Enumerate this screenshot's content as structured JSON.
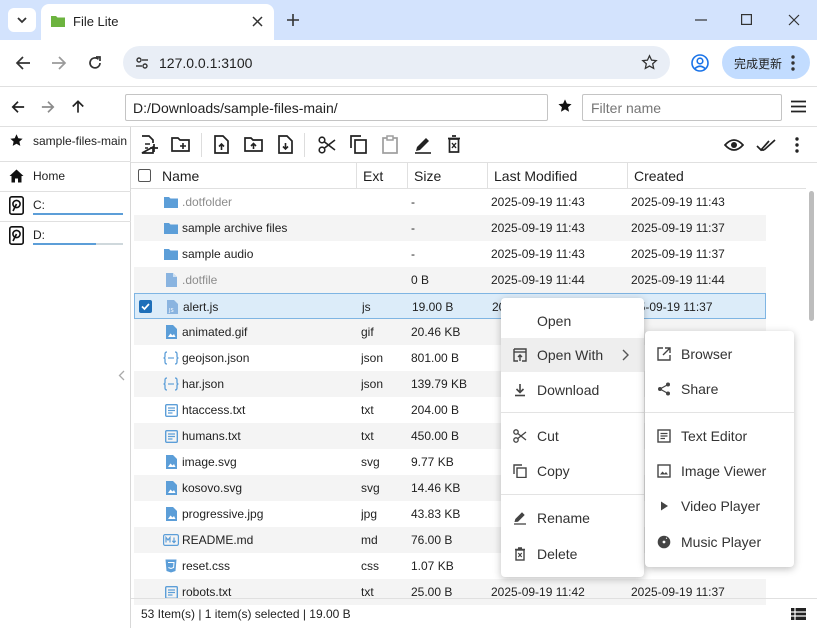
{
  "browser": {
    "tab_title": "File Lite",
    "url": "127.0.0.1:3100",
    "update_label": "完成更新"
  },
  "pathbar": {
    "path": "D:/Downloads/sample-files-main/",
    "filter_placeholder": "Filter name"
  },
  "sidebar": {
    "favorite": "sample-files-main",
    "home": "Home",
    "drives": [
      {
        "label": "C:",
        "used_fraction": 1.0
      },
      {
        "label": "D:",
        "used_fraction": 0.7
      }
    ]
  },
  "columns": {
    "name": "Name",
    "ext": "Ext",
    "size": "Size",
    "modified": "Last Modified",
    "created": "Created"
  },
  "files": [
    {
      "name": ".dotfolder",
      "ext": "",
      "size": "-",
      "modified": "2025-09-19 11:43",
      "created": "2025-09-19 11:43",
      "type": "folder",
      "hidden": true
    },
    {
      "name": "sample archive files",
      "ext": "",
      "size": "-",
      "modified": "2025-09-19 11:43",
      "created": "2025-09-19 11:37",
      "type": "folder"
    },
    {
      "name": "sample audio",
      "ext": "",
      "size": "-",
      "modified": "2025-09-19 11:43",
      "created": "2025-09-19 11:37",
      "type": "folder"
    },
    {
      "name": ".dotfile",
      "ext": "",
      "size": "0 B",
      "modified": "2025-09-19 11:44",
      "created": "2025-09-19 11:44",
      "type": "file",
      "hidden": true
    },
    {
      "name": "alert.js",
      "ext": "js",
      "size": "19.00 B",
      "modified": "20",
      "created": "25-09-19 11:37",
      "type": "file",
      "selected": true
    },
    {
      "name": "animated.gif",
      "ext": "gif",
      "size": "20.46 KB",
      "modified": "",
      "created": "",
      "type": "image"
    },
    {
      "name": "geojson.json",
      "ext": "json",
      "size": "801.00 B",
      "modified": "",
      "created": "",
      "type": "json"
    },
    {
      "name": "har.json",
      "ext": "json",
      "size": "139.79 KB",
      "modified": "",
      "created": "",
      "type": "json"
    },
    {
      "name": "htaccess.txt",
      "ext": "txt",
      "size": "204.00 B",
      "modified": "",
      "created": "",
      "type": "text"
    },
    {
      "name": "humans.txt",
      "ext": "txt",
      "size": "450.00 B",
      "modified": "",
      "created": "",
      "type": "text"
    },
    {
      "name": "image.svg",
      "ext": "svg",
      "size": "9.77 KB",
      "modified": "",
      "created": "",
      "type": "image"
    },
    {
      "name": "kosovo.svg",
      "ext": "svg",
      "size": "14.46 KB",
      "modified": "",
      "created": "",
      "type": "image"
    },
    {
      "name": "progressive.jpg",
      "ext": "jpg",
      "size": "43.83 KB",
      "modified": "",
      "created": "",
      "type": "image"
    },
    {
      "name": "README.md",
      "ext": "md",
      "size": "76.00 B",
      "modified": "",
      "created": "",
      "type": "markdown"
    },
    {
      "name": "reset.css",
      "ext": "css",
      "size": "1.07 KB",
      "modified": "",
      "created": "",
      "type": "css"
    },
    {
      "name": "robots.txt",
      "ext": "txt",
      "size": "25.00 B",
      "modified": "2025-09-19 11:42",
      "created": "2025-09-19 11:37",
      "type": "text"
    }
  ],
  "status": "53 Item(s) | 1 item(s) selected | 19.00 B",
  "context_menu": {
    "open": "Open",
    "open_with": "Open With",
    "download": "Download",
    "cut": "Cut",
    "copy": "Copy",
    "rename": "Rename",
    "delete": "Delete"
  },
  "submenu": {
    "browser": "Browser",
    "share": "Share",
    "text_editor": "Text Editor",
    "image_viewer": "Image Viewer",
    "video_player": "Video Player",
    "music_player": "Music Player"
  },
  "colors": {
    "tabstrip": "#d3e3fd",
    "folder_icon": "#5c9ed8",
    "selection": "#dcecf9"
  }
}
